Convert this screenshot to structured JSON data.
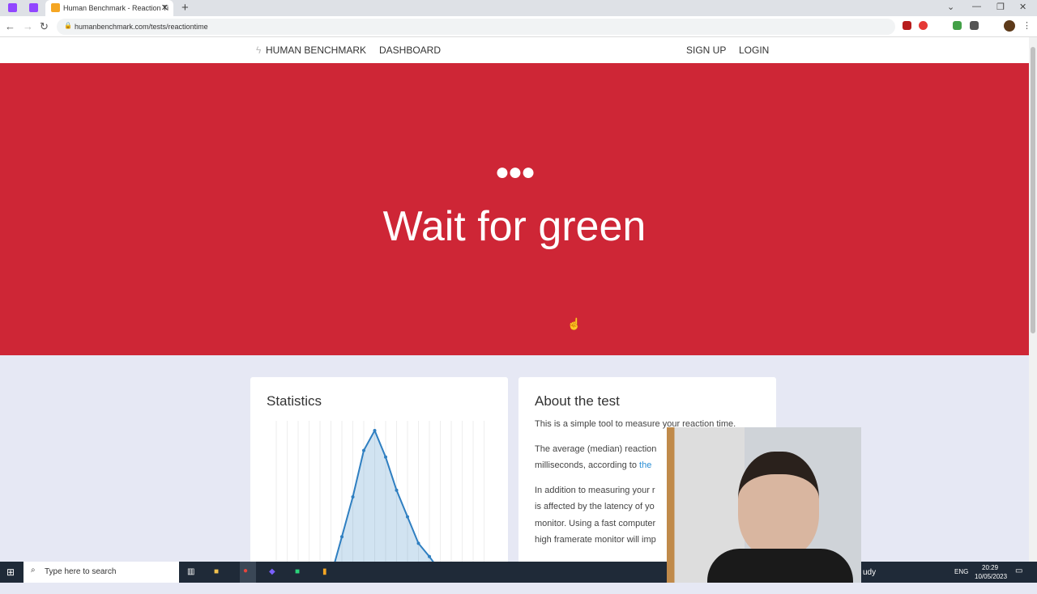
{
  "browser": {
    "tab_title": "Human Benchmark - Reaction Ti",
    "url": "humanbenchmark.com/tests/reactiontime"
  },
  "site": {
    "brand": "HUMAN BENCHMARK",
    "nav": {
      "dashboard": "DASHBOARD",
      "signup": "SIGN UP",
      "login": "LOGIN"
    },
    "hero": {
      "dots": "●●●",
      "title": "Wait for green",
      "bg_color": "#ce2636"
    },
    "statistics": {
      "title": "Statistics",
      "chart_data": {
        "type": "area",
        "x": [
          0,
          1,
          2,
          3,
          4,
          5,
          6,
          7,
          8
        ],
        "values": [
          0.2,
          0.5,
          0.85,
          1.0,
          0.8,
          0.55,
          0.35,
          0.15,
          0.05
        ],
        "grid": "vertical",
        "color": "#2f7fc1"
      }
    },
    "about": {
      "title": "About the test",
      "p1": "This is a simple tool to measure your reaction time.",
      "p2a": "The average (median) reaction",
      "p2b": "milliseconds, according to ",
      "p2link": "the",
      "p3a": "In addition to measuring your r",
      "p3b": "is affected by the latency of yo",
      "p3c": "monitor. Using a fast computer",
      "p3d": "high framerate monitor will imp"
    }
  },
  "taskbar": {
    "search_placeholder": "Type here to search",
    "tray_text": "udy",
    "lang": "ENG",
    "time": "20:29",
    "date": "10/05/2023"
  }
}
